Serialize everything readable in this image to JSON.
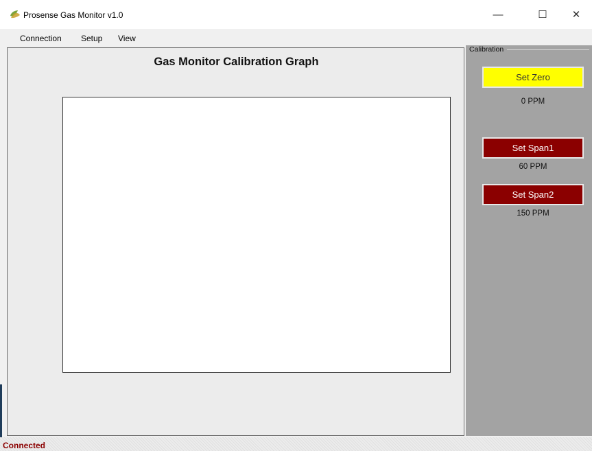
{
  "window": {
    "title": "Prosense Gas Monitor v1.0",
    "controls": {
      "minimize": "—",
      "maximize": "☐",
      "close": "✕"
    }
  },
  "menu": {
    "items": [
      "Connection",
      "Setup",
      "View"
    ]
  },
  "graph": {
    "title": "Gas Monitor Calibration Graph"
  },
  "calibration": {
    "group_label": "Calibration",
    "zero": {
      "button": "Set Zero",
      "value": "0 PPM",
      "color": "#ffff00"
    },
    "span1": {
      "button": "Set Span1",
      "value": "60 PPM",
      "color": "#8b0000"
    },
    "span2": {
      "button": "Set Span2",
      "value": "150 PPM",
      "color": "#8b0000"
    }
  },
  "status": {
    "text": "Connected",
    "color": "#8b0000"
  }
}
